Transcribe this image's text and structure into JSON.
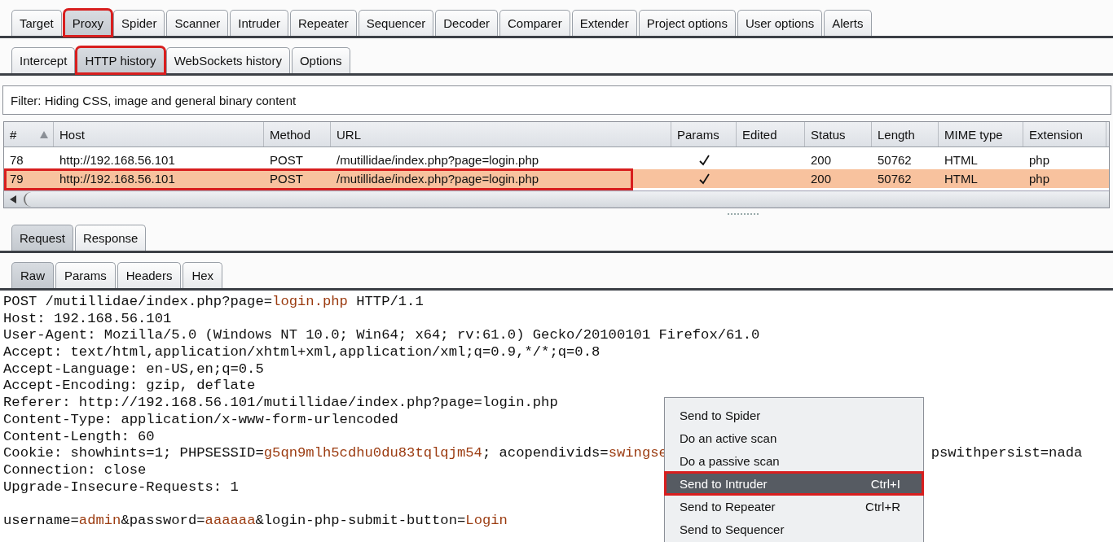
{
  "main_tabs": [
    {
      "label": "Target",
      "selected": false,
      "highlighted": false
    },
    {
      "label": "Proxy",
      "selected": true,
      "highlighted": true
    },
    {
      "label": "Spider",
      "selected": false,
      "highlighted": false
    },
    {
      "label": "Scanner",
      "selected": false,
      "highlighted": false
    },
    {
      "label": "Intruder",
      "selected": false,
      "highlighted": false
    },
    {
      "label": "Repeater",
      "selected": false,
      "highlighted": false
    },
    {
      "label": "Sequencer",
      "selected": false,
      "highlighted": false
    },
    {
      "label": "Decoder",
      "selected": false,
      "highlighted": false
    },
    {
      "label": "Comparer",
      "selected": false,
      "highlighted": false
    },
    {
      "label": "Extender",
      "selected": false,
      "highlighted": false
    },
    {
      "label": "Project options",
      "selected": false,
      "highlighted": false
    },
    {
      "label": "User options",
      "selected": false,
      "highlighted": false
    },
    {
      "label": "Alerts",
      "selected": false,
      "highlighted": false
    }
  ],
  "sub_tabs": [
    {
      "label": "Intercept",
      "selected": false,
      "highlighted": false
    },
    {
      "label": "HTTP history",
      "selected": true,
      "highlighted": true
    },
    {
      "label": "WebSockets history",
      "selected": false,
      "highlighted": false
    },
    {
      "label": "Options",
      "selected": false,
      "highlighted": false
    }
  ],
  "filter": "Filter: Hiding CSS, image and general binary content",
  "table": {
    "columns": [
      {
        "label": "#",
        "sorted": true
      },
      {
        "label": "Host",
        "sorted": false
      },
      {
        "label": "Method",
        "sorted": false
      },
      {
        "label": "URL",
        "sorted": false
      },
      {
        "label": "Params",
        "sorted": false
      },
      {
        "label": "Edited",
        "sorted": false
      },
      {
        "label": "Status",
        "sorted": false
      },
      {
        "label": "Length",
        "sorted": false
      },
      {
        "label": "MIME type",
        "sorted": false
      },
      {
        "label": "Extension",
        "sorted": false
      }
    ],
    "rows": [
      {
        "number": "78",
        "host": "http://192.168.56.101",
        "method": "POST",
        "url": "/mutillidae/index.php?page=login.php",
        "params": true,
        "status": "200",
        "length": "50762",
        "mime_type": "HTML",
        "extension": "php",
        "selected": false,
        "highlighted": false
      },
      {
        "number": "79",
        "host": "http://192.168.56.101",
        "method": "POST",
        "url": "/mutillidae/index.php?page=login.php",
        "params": true,
        "status": "200",
        "length": "50762",
        "mime_type": "HTML",
        "extension": "php",
        "selected": true,
        "highlighted": true
      }
    ]
  },
  "message_tabs": [
    {
      "label": "Request",
      "selected": true
    },
    {
      "label": "Response",
      "selected": false
    }
  ],
  "view_tabs": [
    {
      "label": "Raw",
      "selected": true
    },
    {
      "label": "Params",
      "selected": false
    },
    {
      "label": "Headers",
      "selected": false
    },
    {
      "label": "Hex",
      "selected": false
    }
  ],
  "request_headers": [
    {
      "segments": [
        {
          "text": "POST /mutillidae/index.php?page=",
          "value": false
        },
        {
          "text": "login.php",
          "value": true
        },
        {
          "text": " HTTP/1.1",
          "value": false
        }
      ]
    },
    {
      "segments": [
        {
          "text": "Host: 192.168.56.101",
          "value": false
        }
      ]
    },
    {
      "segments": [
        {
          "text": "User-Agent: Mozilla/5.0 (Windows NT 10.0; Win64; x64; rv:61.0) Gecko/20100101 Firefox/61.0",
          "value": false
        }
      ]
    },
    {
      "segments": [
        {
          "text": "Accept: text/html,application/xhtml+xml,application/xml;q=0.9,*/*;q=0.8",
          "value": false
        }
      ]
    },
    {
      "segments": [
        {
          "text": "Accept-Language: en-US,en;q=0.5",
          "value": false
        }
      ]
    },
    {
      "segments": [
        {
          "text": "Accept-Encoding: gzip, deflate",
          "value": false
        }
      ]
    },
    {
      "segments": [
        {
          "text": "Referer: http://192.168.56.101/mutillidae/index.php?page=login.php",
          "value": false
        }
      ]
    },
    {
      "segments": [
        {
          "text": "Content-Type: application/x-www-form-urlencoded",
          "value": false
        }
      ]
    },
    {
      "segments": [
        {
          "text": "Content-Length: 60",
          "value": false
        }
      ]
    },
    {
      "segments": [
        {
          "text": "Cookie: showhints=1; PHPSESSID=",
          "value": false
        },
        {
          "text": "g5qn9mlh5cdhu0du83tqlqjm54",
          "value": true
        },
        {
          "text": "; acopendivids=",
          "value": false
        },
        {
          "text": "swingse",
          "value": true
        }
      ],
      "tail": "pswithpersist=nada"
    },
    {
      "segments": [
        {
          "text": "Connection: close",
          "value": false
        }
      ]
    },
    {
      "segments": [
        {
          "text": "Upgrade-Insecure-Requests: 1",
          "value": false
        }
      ]
    }
  ],
  "request_body": {
    "segments": [
      {
        "text": "username=",
        "value": false
      },
      {
        "text": "admin",
        "value": true
      },
      {
        "text": "&password=",
        "value": false
      },
      {
        "text": "aaaaaa",
        "value": true
      },
      {
        "text": "&login-php-submit-button=",
        "value": false
      },
      {
        "text": "Login",
        "value": true
      }
    ]
  },
  "context_menu": {
    "items": [
      {
        "label": "Send to Spider",
        "selected": false,
        "highlighted": false
      },
      {
        "label": "Do an active scan",
        "selected": false,
        "highlighted": false
      },
      {
        "label": "Do a passive scan",
        "selected": false,
        "highlighted": false
      },
      {
        "label": "Send to Intruder",
        "shortcut": "Ctrl+I",
        "selected": true,
        "highlighted": true
      },
      {
        "label": "Send to Repeater",
        "shortcut": "Ctrl+R",
        "selected": false,
        "highlighted": false
      },
      {
        "label": "Send to Sequencer",
        "selected": false,
        "highlighted": false
      }
    ]
  }
}
